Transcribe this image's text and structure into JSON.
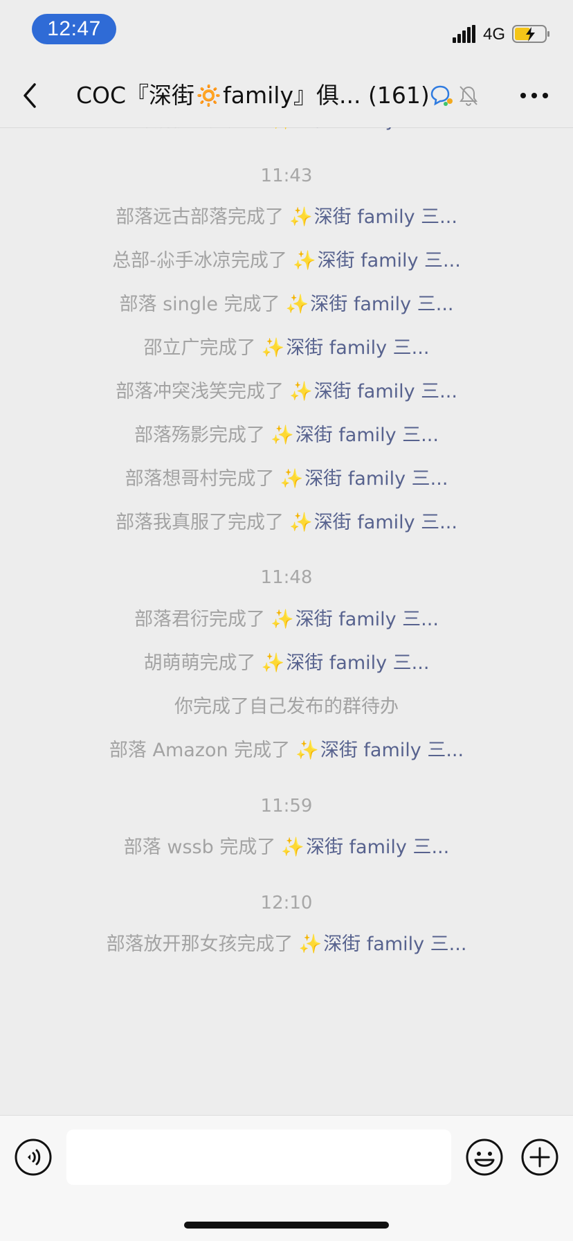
{
  "status_bar": {
    "time": "12:47",
    "network": "4G",
    "icons": {
      "signal": "signal-bars-icon",
      "battery": "battery-charging-icon"
    }
  },
  "nav": {
    "title": "COC『深街🔅family』俱... (161)",
    "icons": {
      "back": "back-chevron-icon",
      "group": "group-chat-icon",
      "mute": "mute-bell-icon",
      "more": "more-dots-icon"
    }
  },
  "colors": {
    "background": "#EDEDED",
    "system_text": "#A3A3A3",
    "link_text": "#57628E",
    "time_pill": "#2F6BD6",
    "sparkle": "#F2C12E"
  },
  "messages": [
    {
      "type": "system",
      "prefix": "部落樱花完成了",
      "spark": "✨",
      "link": "深街 family 三..."
    },
    {
      "type": "time",
      "text": "11:43"
    },
    {
      "type": "system",
      "prefix": "部落远古部落完成了",
      "spark": "✨",
      "link": "深街 family 三..."
    },
    {
      "type": "system",
      "prefix": "总部-尛手冰凉完成了",
      "spark": "✨",
      "link": "深街 family 三..."
    },
    {
      "type": "system",
      "prefix": "部落 single 完成了",
      "spark": "✨",
      "link": "深街 family 三..."
    },
    {
      "type": "system",
      "prefix": "邵立广完成了",
      "spark": "✨",
      "link": "深街 family 三..."
    },
    {
      "type": "system",
      "prefix": "部落冲突浅笑完成了",
      "spark": "✨",
      "link": "深街 family 三..."
    },
    {
      "type": "system",
      "prefix": "部落殇影完成了",
      "spark": "✨",
      "link": "深街 family 三..."
    },
    {
      "type": "system",
      "prefix": "部落想哥村完成了",
      "spark": "✨",
      "link": "深街 family 三..."
    },
    {
      "type": "system",
      "prefix": "部落我真服了完成了",
      "spark": "✨",
      "link": "深街 family 三..."
    },
    {
      "type": "time",
      "text": "11:48"
    },
    {
      "type": "system",
      "prefix": "部落君衍完成了",
      "spark": "✨",
      "link": "深街 family 三..."
    },
    {
      "type": "system",
      "prefix": "胡萌萌完成了",
      "spark": "✨",
      "link": "深街 family 三..."
    },
    {
      "type": "plain",
      "text": "你完成了自己发布的群待办"
    },
    {
      "type": "system",
      "prefix": "部落 Amazon 完成了",
      "spark": "✨",
      "link": "深街 family 三..."
    },
    {
      "type": "time",
      "text": "11:59"
    },
    {
      "type": "system",
      "prefix": "部落 wssb 完成了",
      "spark": "✨",
      "link": "深街 family 三..."
    },
    {
      "type": "time",
      "text": "12:10"
    },
    {
      "type": "system",
      "prefix": "部落放开那女孩完成了",
      "spark": "✨",
      "link": "深街 family 三..."
    }
  ],
  "input_bar": {
    "placeholder": "",
    "icons": {
      "voice": "voice-input-icon",
      "emoji": "emoji-icon",
      "plus": "plus-icon"
    }
  }
}
